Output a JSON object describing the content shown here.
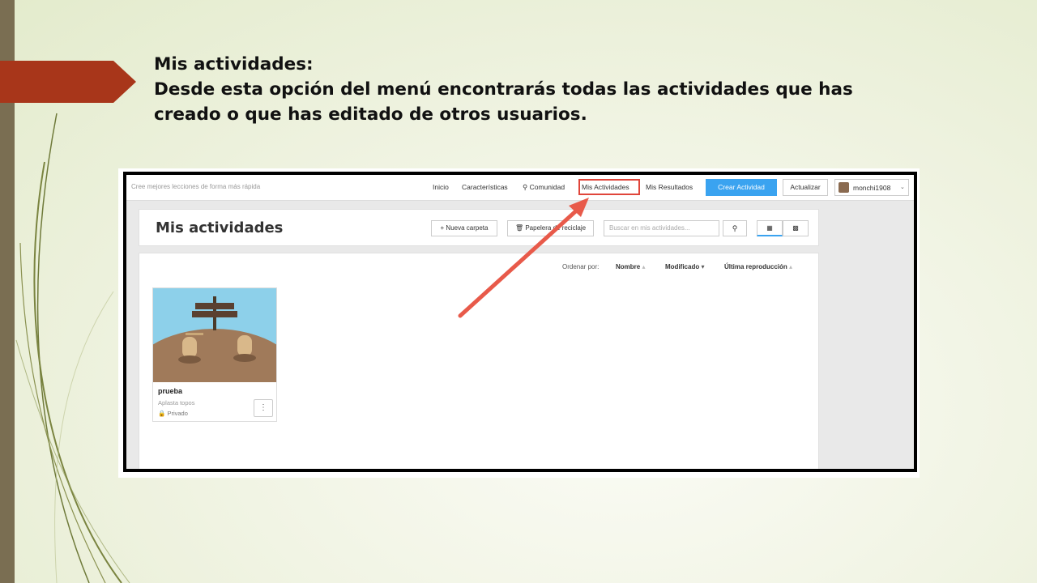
{
  "slide": {
    "heading": "Mis actividades:",
    "line1": "Desde esta opción del menú encontrarás todas las actividades que has",
    "line2": "creado o que has editado de otros usuarios."
  },
  "topnav": {
    "tagline": "Cree mejores lecciones de forma más rápida",
    "items": [
      "Inicio",
      "Características",
      "Comunidad",
      "Mis Actividades",
      "Mis Resultados"
    ],
    "crear": "Crear Actividad",
    "actualizar": "Actualizar",
    "username": "monchi1908"
  },
  "header": {
    "title": "Mis actividades",
    "new_folder": "+ Nueva carpeta",
    "recycle": "Papelera de reciclaje",
    "search_placeholder": "Buscar en mis actividades..."
  },
  "sort": {
    "label": "Ordenar por:",
    "options": [
      "Nombre",
      "Modificado",
      "Última reproducción"
    ]
  },
  "card": {
    "title": "prueba",
    "subtitle": "Aplasta topos",
    "privacy": "Privado"
  },
  "colors": {
    "accent": "#3aa3f0",
    "highlight": "#e0453a",
    "tab": "#a8361a"
  }
}
